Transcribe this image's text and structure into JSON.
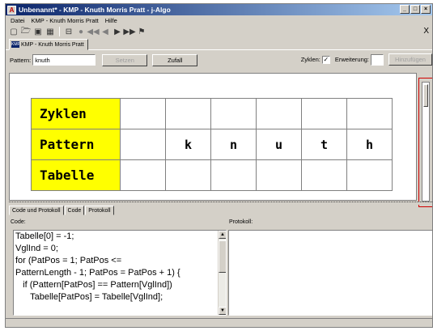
{
  "window": {
    "title": "Unbenannt* - KMP - Knuth Morris Pratt - j-Algo",
    "buttons": [
      "_",
      "□",
      "×"
    ]
  },
  "menubar": {
    "items": [
      "Datei",
      "KMP - Knuth Morris Pratt",
      "Hilfe"
    ]
  },
  "toolbar": {
    "icons": [
      "new-file-icon",
      "open-folder-icon",
      "save-icon",
      "print-icon",
      "fit-view-icon",
      "record-icon",
      "skip-back-icon",
      "step-back-icon",
      "step-forward-icon",
      "skip-forward-icon",
      "finish-flag-icon"
    ],
    "glyphs": [
      "▢",
      "🗁",
      "▣",
      "▦",
      "⊟",
      "●",
      "◀◀",
      "◀",
      "▶",
      "▶▶",
      "⚑"
    ],
    "right_glyph": "X"
  },
  "doc_tab": {
    "icon_text": "KMP",
    "label": "KMP - Knuth Morris Pratt"
  },
  "controls": {
    "pattern_label": "Pattern:",
    "pattern_value": "knuth",
    "setzen_label": "Setzen",
    "zufall_label": "Zufall",
    "zyklen_label": "Zyklen:",
    "zyklen_checked": true,
    "check_glyph": "✓",
    "erweiterung_label": "Erweiterung:",
    "hinzufuegen_label": "Hinzufügen"
  },
  "kmp_table": {
    "rows": [
      {
        "label": "Zyklen",
        "cells": [
          "",
          "",
          "",
          "",
          "",
          ""
        ]
      },
      {
        "label": "Pattern",
        "cells": [
          "",
          "k",
          "n",
          "u",
          "t",
          "h"
        ]
      },
      {
        "label": "Tabelle",
        "cells": [
          "",
          "",
          "",
          "",
          "",
          ""
        ]
      }
    ]
  },
  "bottom_tabs": [
    "Code und Protokoll",
    "Code",
    "Protokoll"
  ],
  "code_panel": {
    "label": "Code:",
    "lines": [
      "Tabelle[0] = -1;",
      "VglInd = 0;",
      "for (PatPos = 1; PatPos <=",
      "PatternLength - 1; PatPos = PatPos + 1) {",
      "   if (Pattern[PatPos] == Pattern[VglInd])",
      "      Tabelle[PatPos] = Tabelle[VglInd];"
    ]
  },
  "protokoll_panel": {
    "label": "Protokoll:"
  },
  "colors": {
    "yellow_header": "#ffff00",
    "title_start": "#0a246a",
    "title_end": "#a6caf0",
    "highlight_border": "#d00000"
  }
}
